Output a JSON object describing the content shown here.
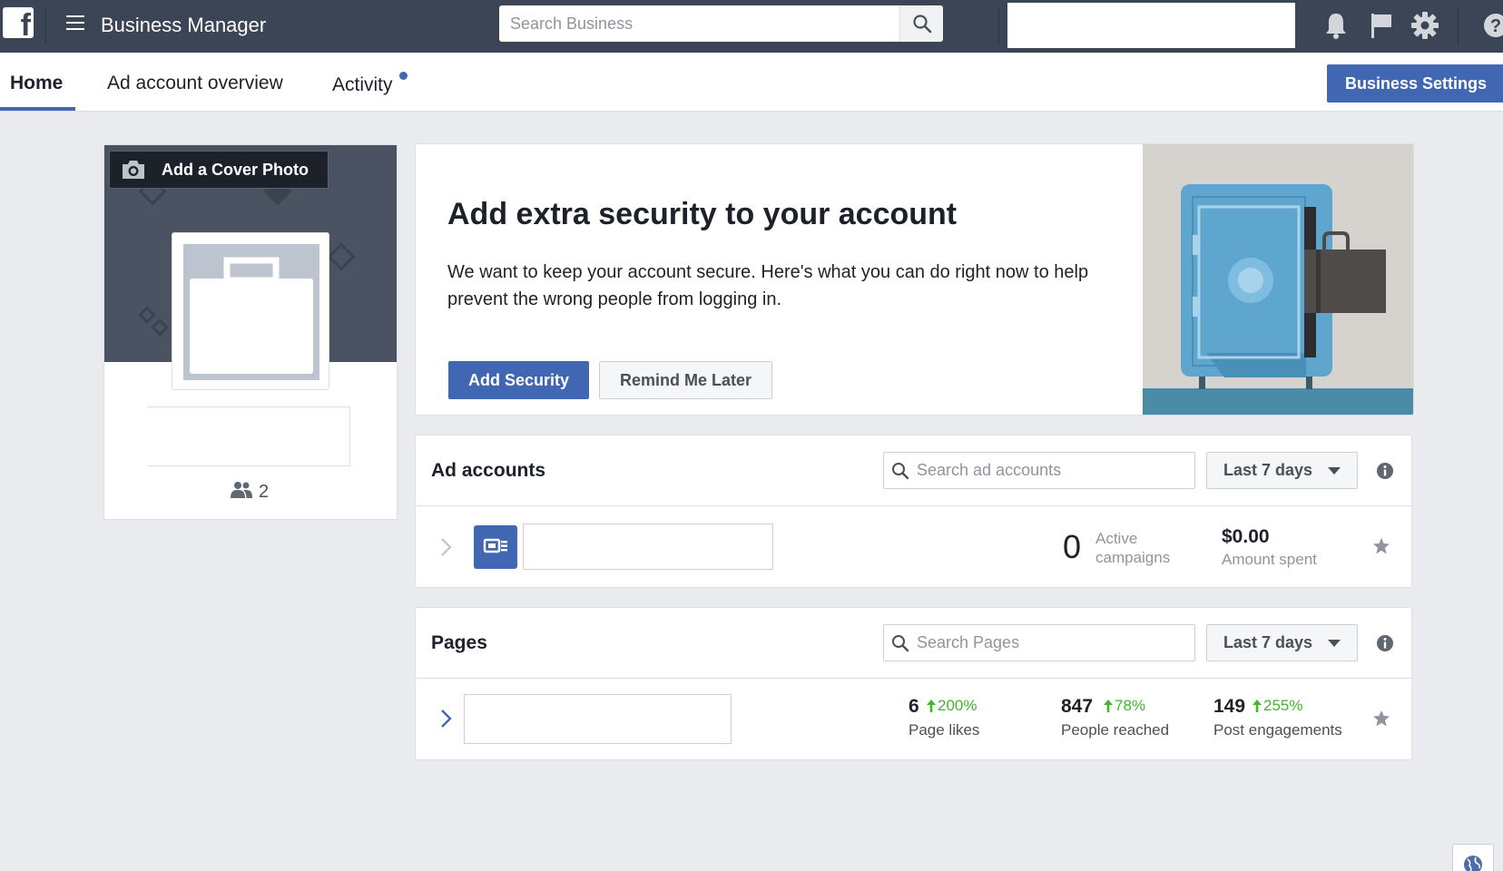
{
  "topbar": {
    "app_title": "Business Manager",
    "search_placeholder": "Search Business"
  },
  "tabs": [
    {
      "label": "Home",
      "active": true
    },
    {
      "label": "Ad account overview",
      "active": false
    },
    {
      "label": "Activity",
      "active": false,
      "has_notification_dot": true
    }
  ],
  "business_settings_label": "Business Settings",
  "profile": {
    "cover_button_label": "Add a Cover Photo",
    "people_count": "2"
  },
  "security": {
    "title": "Add extra security to your account",
    "body": "We want to keep your account secure. Here's what you can do right now to help prevent the wrong people from logging in.",
    "primary_label": "Add Security",
    "secondary_label": "Remind Me Later"
  },
  "ad_accounts": {
    "title": "Ad accounts",
    "search_placeholder": "Search ad accounts",
    "range_label": "Last 7 days",
    "row": {
      "active_campaigns_value": "0",
      "active_campaigns_label_1": "Active",
      "active_campaigns_label_2": "campaigns",
      "amount_value": "$0.00",
      "amount_label": "Amount spent"
    }
  },
  "pages": {
    "title": "Pages",
    "search_placeholder": "Search Pages",
    "range_label": "Last 7 days",
    "row": {
      "likes_value": "6",
      "likes_change": "200%",
      "likes_label": "Page likes",
      "reach_value": "847",
      "reach_change": "78%",
      "reach_label": "People reached",
      "engage_value": "149",
      "engage_change": "255%",
      "engage_label": "Post engagements"
    }
  },
  "colors": {
    "topbar": "#3b4556",
    "accent": "#4267b2",
    "positive": "#42b72a",
    "background": "#e9ebee"
  },
  "icons": [
    "facebook-logo-icon",
    "menu-icon",
    "search-icon",
    "bell-icon",
    "flag-icon",
    "gear-icon",
    "help-icon",
    "camera-icon",
    "people-icon",
    "chevron-right-icon",
    "ad-account-icon",
    "info-icon",
    "caret-down-icon",
    "arrow-up-icon",
    "star-icon",
    "globe-icon"
  ]
}
